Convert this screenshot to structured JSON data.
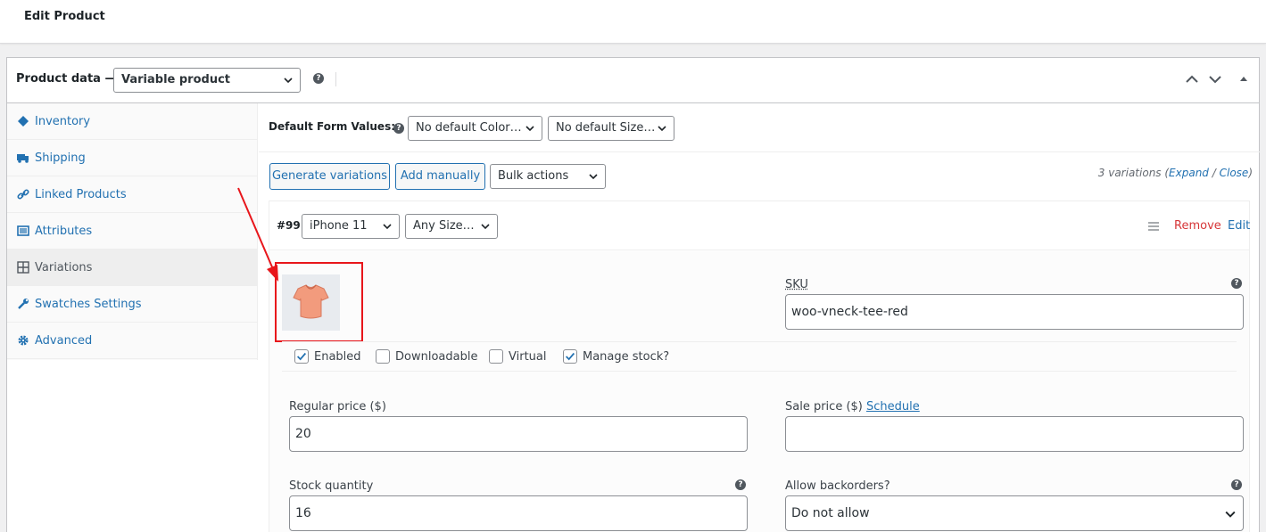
{
  "page": {
    "title": "Edit Product"
  },
  "product_data": {
    "label": "Product data —",
    "type_select": "Variable product"
  },
  "sidebar": {
    "items": [
      {
        "label": "Inventory",
        "icon": "diamond-icon"
      },
      {
        "label": "Shipping",
        "icon": "truck-icon"
      },
      {
        "label": "Linked Products",
        "icon": "link-icon"
      },
      {
        "label": "Attributes",
        "icon": "list-icon"
      },
      {
        "label": "Variations",
        "icon": "grid-icon",
        "active": true
      },
      {
        "label": "Swatches Settings",
        "icon": "wrench-icon"
      },
      {
        "label": "Advanced",
        "icon": "gear-icon"
      }
    ]
  },
  "defaults": {
    "label": "Default Form Values:",
    "color_select": "No default Color…",
    "size_select": "No default Size…"
  },
  "actions": {
    "generate": "Generate variations",
    "add_manually": "Add manually",
    "bulk_select": "Bulk actions",
    "count_text": "3 variations (",
    "expand": "Expand",
    "slash": " / ",
    "close": "Close",
    "close_paren": ")"
  },
  "variation": {
    "number": "#99",
    "color_select": "iPhone 11",
    "size_select": "Any Size…",
    "remove": "Remove",
    "edit": "Edit",
    "sku_label": "SKU",
    "sku_value": "woo-vneck-tee-red",
    "checks": [
      {
        "label": "Enabled",
        "checked": true
      },
      {
        "label": "Downloadable",
        "checked": false
      },
      {
        "label": "Virtual",
        "checked": false
      },
      {
        "label": "Manage stock?",
        "checked": true
      }
    ],
    "regular_price_label": "Regular price ($)",
    "regular_price_value": "20",
    "sale_price_label": "Sale price ($)",
    "schedule": "Schedule",
    "sale_price_value": "",
    "stock_label": "Stock quantity",
    "stock_value": "16",
    "backorders_label": "Allow backorders?",
    "backorders_value": "Do not allow"
  },
  "colors": {
    "accent": "#2271b1",
    "danger": "#d63638",
    "annotation": "#e8161b"
  }
}
